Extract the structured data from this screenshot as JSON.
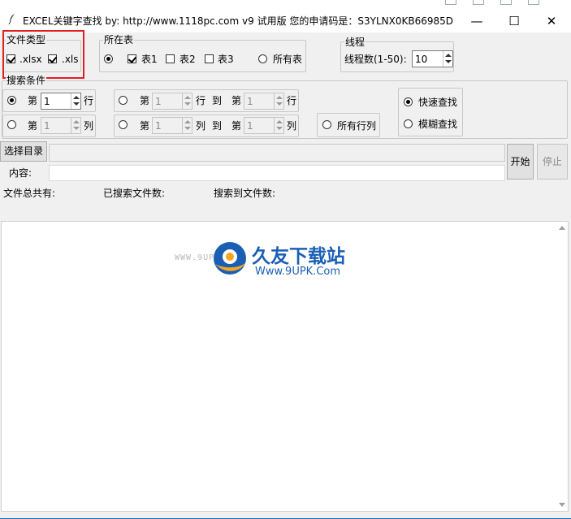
{
  "window": {
    "title": "EXCEL关键字查找   by:  http://www.1118pc.com v9 试用版 您的申请码是：S3YLNX0KB66985D",
    "minimize_glyph": "—",
    "maximize_glyph": "☐",
    "close_glyph": "✕"
  },
  "file_type": {
    "label": "文件类型",
    "xlsx_label": ".xlsx",
    "xls_label": ".xls"
  },
  "sheet": {
    "label": "所在表",
    "sheet1_label": "表1",
    "sheet2_label": "表2",
    "sheet3_label": "表3",
    "all_label": "所有表"
  },
  "threads": {
    "label": "线程",
    "count_label": "线程数(1-50):",
    "count_value": "10"
  },
  "search_cond": {
    "label": "搜索条件",
    "di": "第",
    "row": "行",
    "col": "列",
    "to": "到",
    "row_value": "1",
    "col_value": "1",
    "range_row_from": "1",
    "range_row_to": "1",
    "range_col_from": "1",
    "range_col_to": "1",
    "all_rows_cols": "所有行列",
    "fast_search": "快速查找",
    "fuzzy_search": "模糊查找"
  },
  "actions": {
    "choose_dir": "选择目录",
    "content_label": "内容:",
    "start": "开始",
    "stop": "停止"
  },
  "stats": {
    "total_files": "文件总共有:",
    "searched_files": "已搜索文件数:",
    "found_files": "搜索到文件数:"
  },
  "watermark": {
    "brand": "久友下载站",
    "url": "Www.9UPK.Com",
    "faint": "WWW.9UPK.COM"
  },
  "colors": {
    "highlight_box": "#e02020",
    "logo_blue": "#1a5fb4",
    "logo_orange": "#f5a623"
  }
}
